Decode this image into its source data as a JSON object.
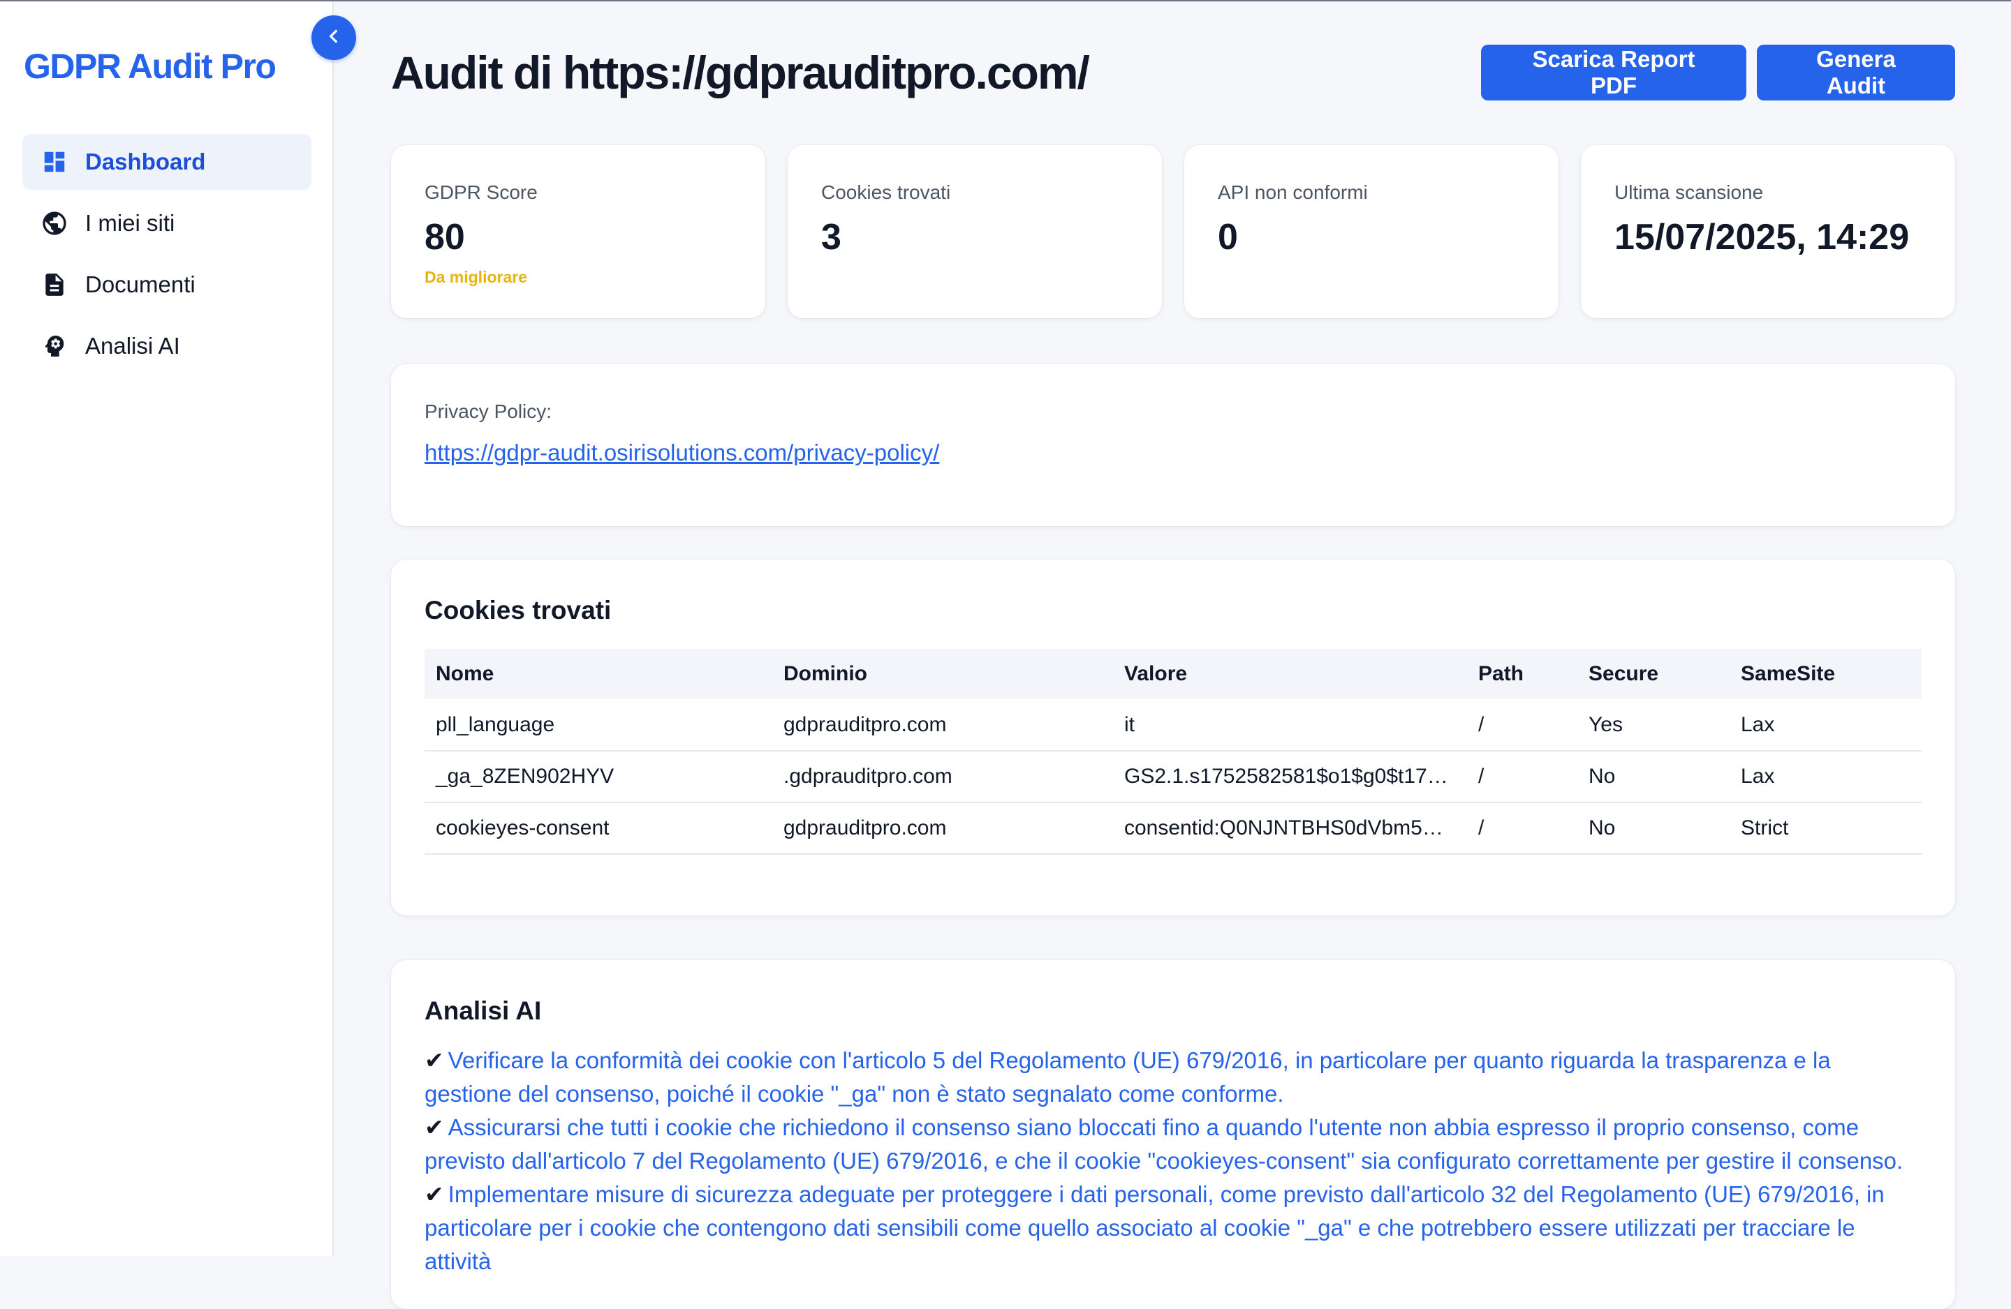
{
  "app": {
    "brand": "GDPR Audit Pro"
  },
  "sidebar": {
    "items": [
      {
        "label": "Dashboard",
        "icon": "dashboard-icon",
        "active": true
      },
      {
        "label": "I miei siti",
        "icon": "globe-icon"
      },
      {
        "label": "Documenti",
        "icon": "document-icon"
      },
      {
        "label": "Analisi AI",
        "icon": "ai-brain-icon"
      }
    ]
  },
  "header": {
    "title": "Audit di https://gdprauditpro.com/",
    "download_label": "Scarica Report PDF",
    "generate_label": "Genera Audit"
  },
  "stats": [
    {
      "label": "GDPR Score",
      "value": "80",
      "note": "Da migliorare"
    },
    {
      "label": "Cookies trovati",
      "value": "3"
    },
    {
      "label": "API non conformi",
      "value": "0"
    },
    {
      "label": "Ultima scansione",
      "value": "15/07/2025, 14:29"
    }
  ],
  "privacy": {
    "label": "Privacy Policy:",
    "link": "https://gdpr-audit.osirisolutions.com/privacy-policy/"
  },
  "cookies": {
    "title": "Cookies trovati",
    "columns": [
      "Nome",
      "Dominio",
      "Valore",
      "Path",
      "Secure",
      "SameSite"
    ],
    "rows": [
      [
        "pll_language",
        "gdprauditpro.com",
        "it",
        "/",
        "Yes",
        "Lax"
      ],
      [
        "_ga_8ZEN902HYV",
        ".gdprauditpro.com",
        "GS2.1.s1752582581$o1$g0$t1752…",
        "/",
        "No",
        "Lax"
      ],
      [
        "cookieyes-consent",
        "gdprauditpro.com",
        "consentid:Q0NJNTBHS0dVbm5…",
        "/",
        "No",
        "Strict"
      ]
    ]
  },
  "ai": {
    "title": "Analisi AI",
    "check": "✔",
    "items": [
      "Verificare la conformità dei cookie con l'articolo 5 del Regolamento (UE) 679/2016, in particolare per quanto riguarda la trasparenza e la gestione del consenso, poiché il cookie \"_ga\" non è stato segnalato come conforme.",
      "Assicurarsi che tutti i cookie che richiedono il consenso siano bloccati fino a quando l'utente non abbia espresso il proprio consenso, come previsto dall'articolo 7 del Regolamento (UE) 679/2016, e che il cookie \"cookieyes-consent\" sia configurato correttamente per gestire il consenso.",
      "Implementare misure di sicurezza adeguate per proteggere i dati personali, come previsto dall'articolo 32 del Regolamento (UE) 679/2016, in particolare per i cookie che contengono dati sensibili come quello associato al cookie \"_ga\" e che potrebbero essere utilizzati per tracciare le attività"
    ]
  },
  "colors": {
    "accent": "#2563eb",
    "warning": "#eab308",
    "text": "#111827",
    "muted": "#4b5563"
  }
}
